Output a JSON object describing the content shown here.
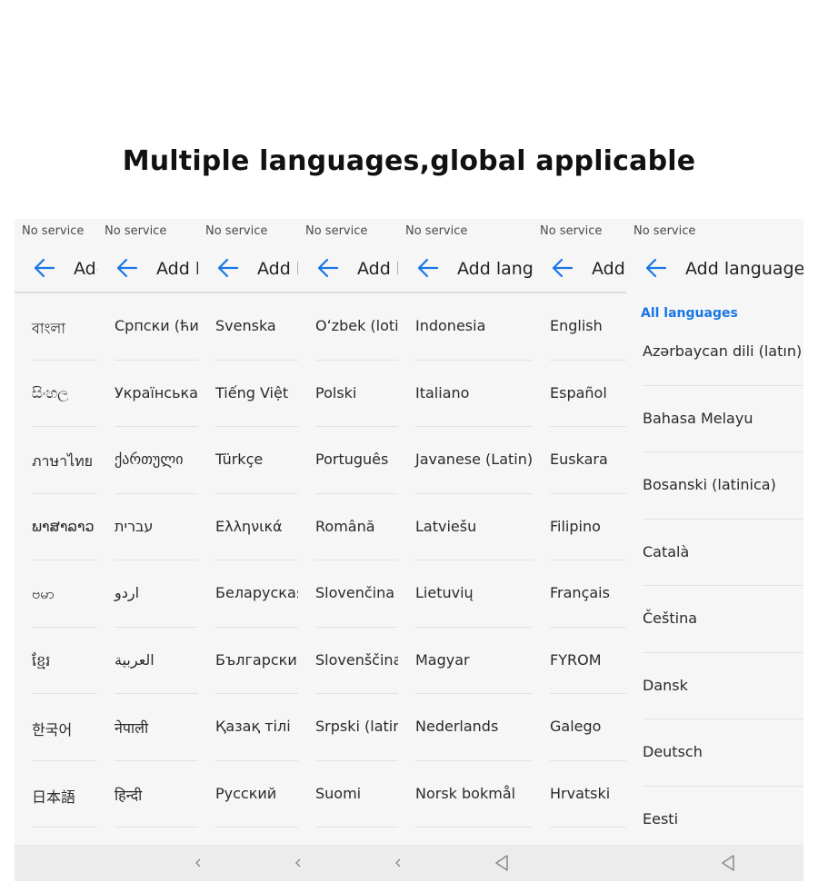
{
  "heading": "Multiple languages,global applicable",
  "accent_color": "#1976e5",
  "panels": [
    {
      "status": "No service",
      "toolbar_title": "Add language",
      "items": [
        "বাংলা",
        "සිංහල",
        "ภาษาไทย",
        "ພາສາລາວ",
        "ဗမာ",
        "ខ្មែរ",
        "한국어",
        "日本語"
      ]
    },
    {
      "status": "No service",
      "toolbar_title": "Add language",
      "items": [
        "Српски (ћирилица)",
        "Українська",
        "ქართული",
        "עברית",
        "اردو",
        "العربية",
        "नेपाली",
        "हिन्दी"
      ]
    },
    {
      "status": "No service",
      "toolbar_title": "Add language",
      "items": [
        "Svenska",
        "Tiếng Việt",
        "Türkçe",
        "Ελληνικά",
        "Беларуская",
        "Български",
        "Қазақ тілі",
        "Русский"
      ]
    },
    {
      "status": "No service",
      "toolbar_title": "Add language",
      "items": [
        "Oʻzbek (lotin)",
        "Polski",
        "Português",
        "Română",
        "Slovenčina",
        "Slovenščina",
        "Srpski (latinica)",
        "Suomi"
      ]
    },
    {
      "status": "No service",
      "toolbar_title": "Add language",
      "items": [
        "Indonesia",
        "Italiano",
        "Javanese (Latin)",
        "Latviešu",
        "Lietuvių",
        "Magyar",
        "Nederlands",
        "Norsk bokmål"
      ]
    },
    {
      "status": "No service",
      "toolbar_title": "Add language",
      "items": [
        "English",
        "Español",
        "Euskara",
        "Filipino",
        "Français",
        "FYROM",
        "Galego",
        "Hrvatski"
      ]
    },
    {
      "status": "No service",
      "toolbar_title": "Add language",
      "section": "All languages",
      "items": [
        "Azərbaycan dili (latın)",
        "Bahasa Melayu",
        "Bosanski (latinica)",
        "Català",
        "Čeština",
        "Dansk",
        "Deutsch",
        "Eesti"
      ]
    }
  ],
  "nav_icons": [
    "chevron-back-icon",
    "chevron-back-icon",
    "chevron-back-icon",
    "triangle-back-icon",
    "triangle-back-icon"
  ]
}
